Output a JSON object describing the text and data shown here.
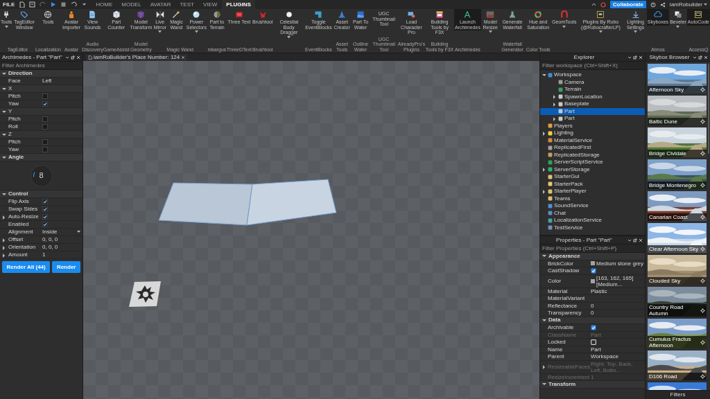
{
  "menu": {
    "file": "FILE",
    "tabs": [
      {
        "label": "HOME",
        "selected": false
      },
      {
        "label": "MODEL",
        "selected": false
      },
      {
        "label": "AVATAR",
        "selected": false
      },
      {
        "label": "TEST",
        "selected": false
      },
      {
        "label": "VIEW",
        "selected": false
      },
      {
        "label": "PLUGINS",
        "selected": true
      }
    ],
    "collaborate": "Collaborate",
    "user": "iamRobuilder"
  },
  "ribbon": [
    {
      "group": "TagEditor",
      "buttons": [
        {
          "label": "Tools",
          "menu": true,
          "active": false
        },
        {
          "label": "TagEditor Window",
          "menu": false,
          "active": false
        }
      ]
    },
    {
      "group": "Localization",
      "buttons": [
        {
          "label": "Tools",
          "menu": false,
          "active": false
        }
      ]
    },
    {
      "group": "Avatar",
      "buttons": [
        {
          "label": "Avatar Importer",
          "menu": false,
          "active": false
        }
      ]
    },
    {
      "group": "Audio Discovery",
      "buttons": [
        {
          "label": "View Sounds",
          "menu": false,
          "active": false
        }
      ]
    },
    {
      "group": "GameAssist",
      "buttons": [
        {
          "label": "Part Counter",
          "menu": false,
          "active": false
        }
      ]
    },
    {
      "group": "Model Geometry",
      "buttons": [
        {
          "label": "Model Transform",
          "menu": false,
          "active": false
        }
      ]
    },
    {
      "group": "Magic Wand",
      "buttons": [
        {
          "label": "Live Mirror",
          "menu": true,
          "active": false
        },
        {
          "label": "Magic Wand",
          "menu": false,
          "active": false
        },
        {
          "label": "Power Selectors",
          "menu": true,
          "active": false
        }
      ]
    },
    {
      "group": "mkargus",
      "buttons": [
        {
          "label": "Part to Terrain",
          "menu": false,
          "active": false
        }
      ]
    },
    {
      "group": "ThreeDText",
      "buttons": [
        {
          "label": "Three Text",
          "menu": false,
          "active": false
        }
      ]
    },
    {
      "group": "Brushtool",
      "buttons": [
        {
          "label": "Brushtool",
          "menu": false,
          "active": false
        }
      ]
    },
    {
      "buttons": [
        {
          "label": "Celestial Body Dragger",
          "menu": true,
          "active": false
        }
      ]
    },
    {
      "group": "EventBlocks",
      "buttons": [
        {
          "label": "Toggle EventBlocks",
          "menu": false,
          "active": false
        }
      ]
    },
    {
      "group": "Asset Tools",
      "buttons": [
        {
          "label": "Asset Creator",
          "menu": false,
          "active": false
        }
      ]
    },
    {
      "group": "Outline Water",
      "buttons": [
        {
          "label": "Part To Water",
          "menu": false,
          "active": false
        }
      ]
    },
    {
      "group": "UGC Thumbnail Tool",
      "buttons": [
        {
          "label": "UGC Thumbnail Tool",
          "menu": false,
          "active": false
        }
      ]
    },
    {
      "group": "AlreadyPro's Plugins",
      "buttons": [
        {
          "label": "Load Character Pro",
          "menu": false,
          "active": false
        }
      ]
    },
    {
      "group": "Building Tools by F3X",
      "buttons": [
        {
          "label": "Building Tools by F3X",
          "menu": false,
          "active": false
        }
      ]
    },
    {
      "group": "Archimedes",
      "buttons": [
        {
          "label": "Launch Archimedes",
          "menu": false,
          "active": true
        }
      ]
    },
    {
      "buttons": [
        {
          "label": "Model Resize",
          "menu": true,
          "active": false
        }
      ]
    },
    {
      "group": "Waterfall Generator",
      "buttons": [
        {
          "label": "Generate Waterfall",
          "menu": false,
          "active": false
        }
      ]
    },
    {
      "group": "Color Tools",
      "buttons": [
        {
          "label": "Hue and Saturation",
          "menu": false,
          "active": false
        }
      ]
    },
    {
      "buttons": [
        {
          "label": "GeomTools",
          "menu": true,
          "active": false
        }
      ]
    },
    {
      "buttons": [
        {
          "label": "Plugins By Robo (@RobocrafterLP)",
          "menu": true,
          "active": false
        }
      ]
    },
    {
      "buttons": [
        {
          "label": "Lighting Settings",
          "menu": true,
          "active": false
        }
      ]
    },
    {
      "group": "Atmos",
      "buttons": [
        {
          "label": "Skyboxes",
          "menu": false,
          "active": true
        }
      ]
    },
    {
      "buttons": [
        {
          "label": "Beveler",
          "menu": true,
          "active": false
        }
      ]
    },
    {
      "group": "AccessQ",
      "buttons": [
        {
          "label": "AutoCode",
          "menu": false,
          "active": true
        }
      ]
    }
  ],
  "archimedes": {
    "title": "Archimedes - Part \"Part\"",
    "filter_placeholder": "Filter Archimedes",
    "sections": [
      {
        "label": "Direction",
        "expanded": true,
        "rows": [
          {
            "kind": "value",
            "label": "Face",
            "value": "Left"
          },
          {
            "kind": "group",
            "label": "X",
            "expanded": true,
            "children": [
              {
                "kind": "check",
                "label": "Pitch",
                "checked": false
              },
              {
                "kind": "check",
                "label": "Yaw",
                "checked": true
              }
            ]
          },
          {
            "kind": "group",
            "label": "Y",
            "expanded": true,
            "children": [
              {
                "kind": "check",
                "label": "Pitch",
                "checked": false
              },
              {
                "kind": "check",
                "label": "Roll",
                "checked": false
              }
            ]
          },
          {
            "kind": "group",
            "label": "Z",
            "expanded": true,
            "children": [
              {
                "kind": "check",
                "label": "Pitch",
                "checked": false
              },
              {
                "kind": "check",
                "label": "Yaw",
                "checked": false
              }
            ]
          }
        ]
      },
      {
        "label": "Angle",
        "expanded": true,
        "rows": [
          {
            "kind": "dial",
            "value": "8"
          }
        ]
      },
      {
        "label": "Control",
        "expanded": true,
        "rows": [
          {
            "kind": "check",
            "label": "Flip Axis",
            "checked": true
          },
          {
            "kind": "check",
            "label": "Swap Sides",
            "checked": true
          },
          {
            "kind": "check",
            "label": "Auto-Resize",
            "checked": true,
            "expanded": false
          },
          {
            "kind": "check",
            "label": "Enabled",
            "checked": true
          },
          {
            "kind": "dropdown",
            "label": "Alignment",
            "value": "Inside"
          },
          {
            "kind": "value",
            "label": "Offset",
            "value": "0, 0, 0",
            "expanded": false
          },
          {
            "kind": "value",
            "label": "Orientation",
            "value": "0, 0, 0",
            "expanded": false
          },
          {
            "kind": "value",
            "label": "Amount",
            "value": "1",
            "expanded": false
          }
        ]
      }
    ],
    "buttons": [
      "Render All (44)",
      "Render"
    ]
  },
  "document_tab": "iamRoBuilder's Place Number: 124",
  "explorer": {
    "title": "Explorer",
    "filter_placeholder": "Filter workspace (Ctrl+Shift+X)",
    "items": [
      {
        "label": "Workspace",
        "color": "#3b8fd6",
        "expanded": true,
        "selected": false,
        "children": [
          {
            "label": "Camera",
            "color": "#9a9a9a",
            "selected": false
          },
          {
            "label": "Terrain",
            "color": "#3aa060",
            "selected": false
          },
          {
            "label": "SpawnLocation",
            "color": "#c8c8c8",
            "expanded": false,
            "selected": false
          },
          {
            "label": "Baseplate",
            "color": "#c8c8c8",
            "expanded": false,
            "selected": false
          },
          {
            "label": "Part",
            "color": "#c8c8c8",
            "selected": true
          },
          {
            "label": "Part",
            "color": "#c8c8c8",
            "expanded": false,
            "selected": false
          }
        ]
      },
      {
        "label": "Players",
        "color": "#e0a040",
        "selected": false
      },
      {
        "label": "Lighting",
        "color": "#f0d040",
        "expanded": false,
        "selected": false
      },
      {
        "label": "MaterialService",
        "color": "#d08a40",
        "selected": false
      },
      {
        "label": "ReplicatedFirst",
        "color": "#a0a0a0",
        "selected": false
      },
      {
        "label": "ReplicatedStorage",
        "color": "#c0a060",
        "selected": false
      },
      {
        "label": "ServerScriptService",
        "color": "#30a060",
        "selected": false
      },
      {
        "label": "ServerStorage",
        "color": "#2fb070",
        "expanded": false,
        "selected": false
      },
      {
        "label": "StarterGui",
        "color": "#e0c070",
        "selected": false
      },
      {
        "label": "StarterPack",
        "color": "#e6c878",
        "selected": false
      },
      {
        "label": "StarterPlayer",
        "color": "#dcc068",
        "expanded": false,
        "selected": false
      },
      {
        "label": "Teams",
        "color": "#d8bc70",
        "selected": false
      },
      {
        "label": "SoundService",
        "color": "#5090d0",
        "selected": false
      },
      {
        "label": "Chat",
        "color": "#5a8cc8",
        "selected": false
      },
      {
        "label": "LocalizationService",
        "color": "#4aa0a0",
        "selected": false
      },
      {
        "label": "TestService",
        "color": "#7090c0",
        "selected": false
      }
    ]
  },
  "properties": {
    "title": "Properties - Part \"Part\"",
    "filter_placeholder": "Filter Properties (Ctrl+Shift+P)",
    "sections": [
      {
        "label": "Appearance",
        "expanded": true,
        "rows": [
          {
            "kind": "swatch",
            "label": "BrickColor",
            "value": "Medium stone grey",
            "color": "#a3a2a5"
          },
          {
            "kind": "check",
            "label": "CastShadow",
            "checked": true
          },
          {
            "kind": "swatch",
            "label": "Color",
            "value": "[163, 162, 165] [Medium...",
            "color": "#a3a2a5"
          },
          {
            "kind": "text",
            "label": "Material",
            "value": "Plastic"
          },
          {
            "kind": "text",
            "label": "MaterialVariant"
          },
          {
            "kind": "text",
            "label": "Reflectance",
            "value": "0"
          },
          {
            "kind": "text",
            "label": "Transparency",
            "value": "0"
          }
        ]
      },
      {
        "label": "Data",
        "expanded": true,
        "rows": [
          {
            "kind": "check",
            "label": "Archivable",
            "checked": true
          },
          {
            "kind": "text",
            "label": "ClassName",
            "value": "Part",
            "disabled": true
          },
          {
            "kind": "check",
            "label": "Locked",
            "checked": false
          },
          {
            "kind": "text",
            "label": "Name",
            "value": "Part"
          },
          {
            "kind": "text",
            "label": "Parent",
            "value": "Workspace"
          },
          {
            "kind": "text",
            "label": "ResizeableFaces",
            "value": "Right, Top, Back, Left, Botto...",
            "disabled": true,
            "expanded": false
          },
          {
            "kind": "text",
            "label": "ResizeIncrement",
            "value": "1",
            "disabled": true
          }
        ]
      },
      {
        "label": "Transform",
        "expanded": true
      }
    ]
  },
  "skybox_browser": {
    "title": "Skybox Browser",
    "items": [
      {
        "kind": "skybox",
        "name": "Afternoon Sky"
      },
      {
        "kind": "skybox",
        "name": "Baltic Dune"
      },
      {
        "kind": "skybox",
        "name": "Bridge Cividale"
      },
      {
        "kind": "skybox",
        "name": "Bridge Montenegro"
      },
      {
        "kind": "skybox",
        "name": "Canarian Coast"
      },
      {
        "kind": "skybox",
        "name": "Clear Afternoon Sky"
      },
      {
        "kind": "skybox",
        "name": "Clouded Sky"
      },
      {
        "kind": "skybox",
        "name": "Country Road Autumn"
      },
      {
        "kind": "skybox",
        "name": "Cumulus Fractus Afternoon"
      },
      {
        "kind": "skybox",
        "name": "D106 Road"
      },
      {
        "kind": "picture"
      }
    ],
    "footer": "Filters"
  }
}
